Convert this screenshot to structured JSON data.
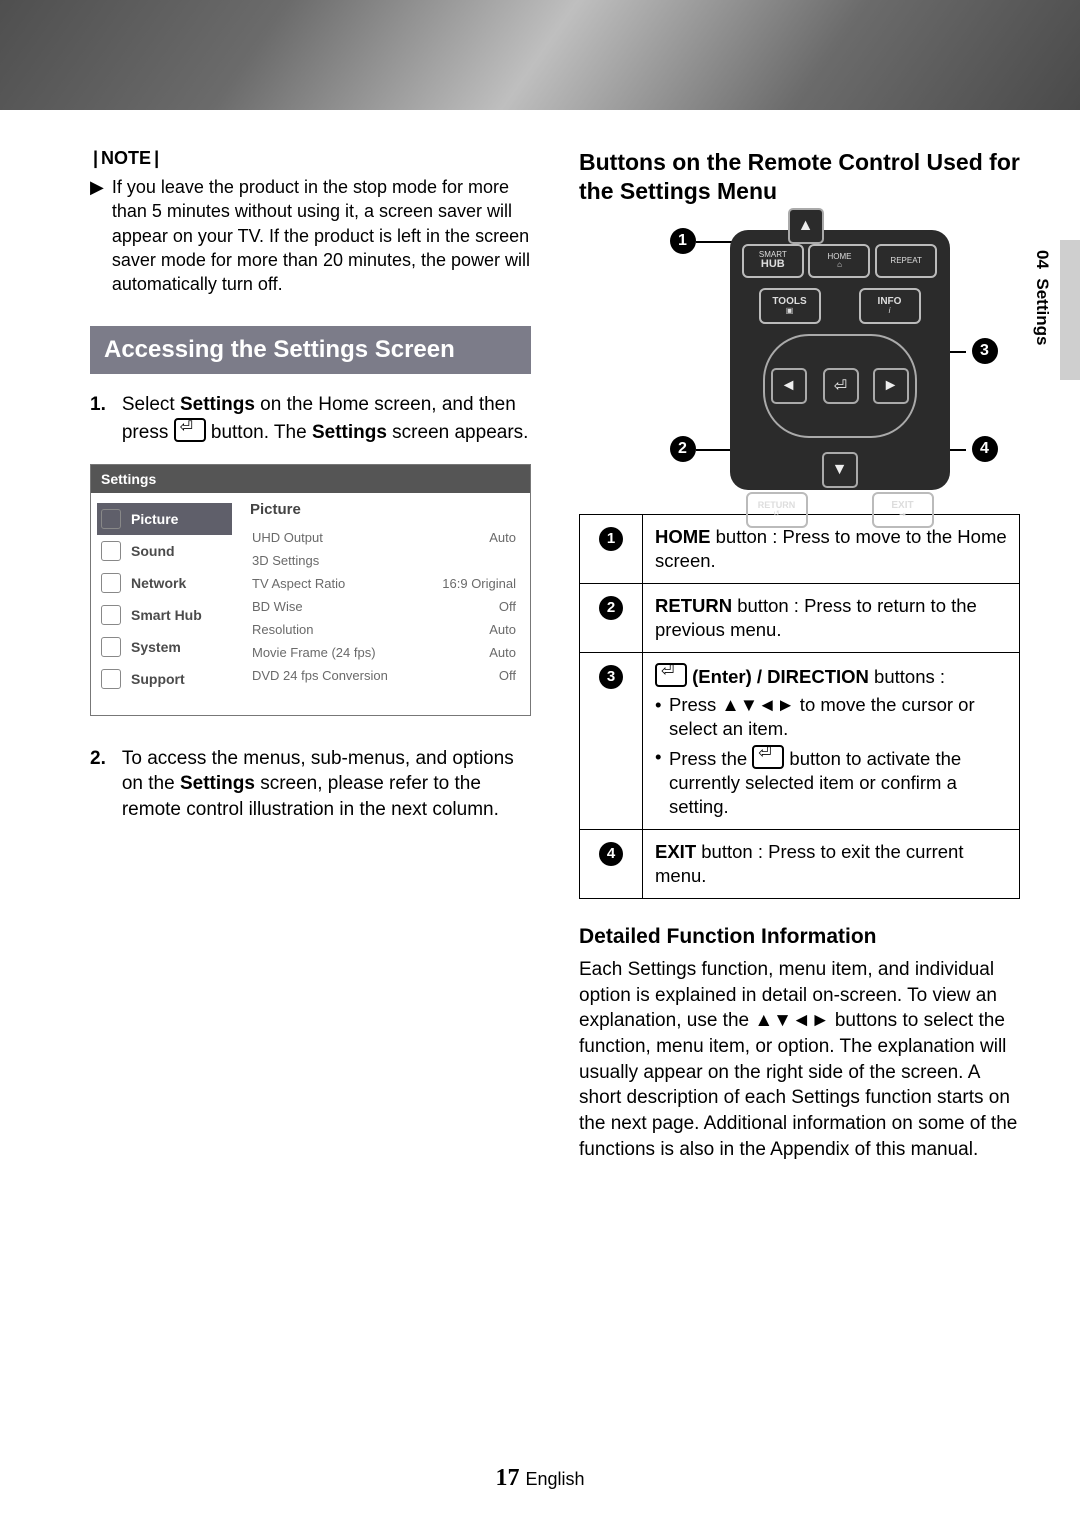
{
  "side": {
    "chapter": "04",
    "label": "Settings"
  },
  "left": {
    "note_label": "NOTE",
    "note_text": "If you leave the product in the stop mode for more than 5 minutes without using it, a screen saver will appear on your TV. If the product is left in the screen saver mode for more than 20 minutes, the power will automatically turn off.",
    "section_title": "Accessing the Settings Screen",
    "step1_a": "Select ",
    "step1_b": "Settings",
    "step1_c": " on the Home screen, and then press ",
    "step1_d": " button. The ",
    "step1_e": "Settings",
    "step1_f": " screen appears.",
    "step2_a": "To access the menus, sub-menus, and options on the ",
    "step2_b": "Settings",
    "step2_c": " screen, please refer to the remote control illustration in the next column."
  },
  "panel": {
    "title": "Settings",
    "categories": [
      "Picture",
      "Sound",
      "Network",
      "Smart Hub",
      "System",
      "Support"
    ],
    "section": "Picture",
    "options": [
      {
        "k": "UHD Output",
        "v": "Auto"
      },
      {
        "k": "3D Settings",
        "v": ""
      },
      {
        "k": "TV Aspect Ratio",
        "v": "16:9 Original"
      },
      {
        "k": "BD Wise",
        "v": "Off"
      },
      {
        "k": "Resolution",
        "v": "Auto"
      },
      {
        "k": "Movie Frame (24 fps)",
        "v": "Auto"
      },
      {
        "k": "DVD 24 fps Conversion",
        "v": "Off"
      }
    ]
  },
  "right": {
    "heading": "Buttons on the Remote Control Used for the Settings Menu",
    "remote": {
      "smart": "SMART",
      "home": "HOME",
      "repeat": "REPEAT",
      "hub": "HUB",
      "tools": "TOOLS",
      "info": "INFO",
      "return": "RETURN",
      "exit": "EXIT"
    },
    "tbl": {
      "r1_a": "HOME",
      "r1_b": " button : Press to move to the Home screen.",
      "r2_a": "RETURN",
      "r2_b": " button : Press to return to the previous menu.",
      "r3_a": "(Enter) / DIRECTION",
      "r3_b": " buttons :",
      "r3_c1": "Press ▲▼◄► to move the cursor or select an item.",
      "r3_c2_a": "Press the ",
      "r3_c2_b": " button to activate the currently selected item or confirm a setting.",
      "r4_a": "EXIT",
      "r4_b": " button : Press to exit the current menu."
    },
    "subheading": "Detailed Function Information",
    "para": "Each Settings function, menu item, and individual option is explained in detail on-screen. To view an explanation, use the ▲▼◄► buttons to select the function, menu item, or option. The explanation will usually appear on the right side of the screen. A short description of each Settings function starts on the next page. Additional information on some of the functions is also in the Appendix of this manual."
  },
  "footer": {
    "num": "17",
    "lang": "English"
  }
}
